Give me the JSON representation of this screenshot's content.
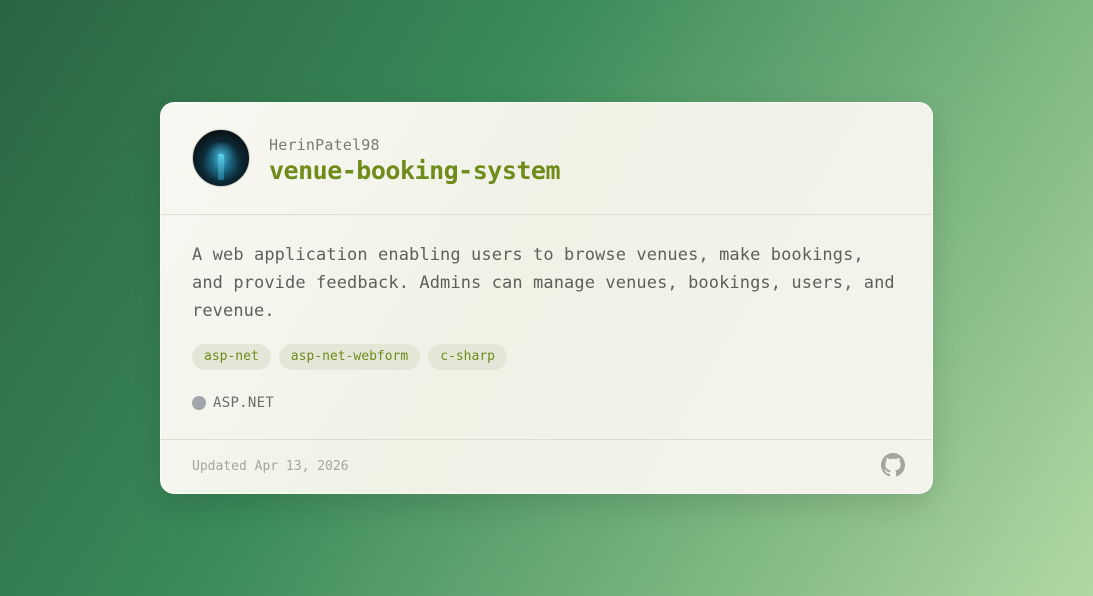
{
  "repo": {
    "owner": "HerinPatel98",
    "name": "venue-booking-system",
    "description": "A web application enabling users to browse venues, make bookings, and provide feedback. Admins can manage venues, bookings, users, and revenue.",
    "topics": [
      "asp-net",
      "asp-net-webform",
      "c-sharp"
    ],
    "language": "ASP.NET",
    "language_color": "#a2a5a9",
    "updated": "Updated Apr 13, 2026",
    "icon": "github-icon"
  },
  "colors": {
    "accent": "#6f8b1a",
    "background_start": "#2a6444",
    "background_end": "#b2d8a2"
  }
}
